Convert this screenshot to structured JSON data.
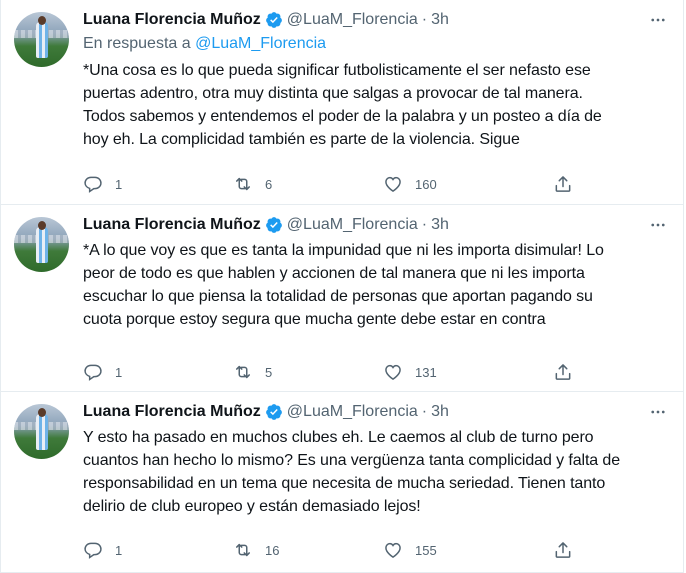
{
  "tweets": [
    {
      "name": "Luana Florencia Muñoz",
      "handle": "@LuaM_Florencia",
      "separator": "·",
      "time": "3h",
      "reply_prefix": "En respuesta a ",
      "reply_handle": "@LuaM_Florencia",
      "text": "*Una cosa es lo que pueda significar futbolisticamente el ser nefasto ese\npuertas adentro, otra muy distinta que salgas a provocar de tal manera.\nTodos sabemos y entendemos el poder de la palabra y un posteo a día de\nhoy eh. La complicidad también es parte de la violencia. Sigue",
      "replies": "1",
      "retweets": "6",
      "likes": "160"
    },
    {
      "name": "Luana Florencia Muñoz",
      "handle": "@LuaM_Florencia",
      "separator": "·",
      "time": "3h",
      "text": "*A lo que voy es que es tanta la impunidad que ni les importa disimular! Lo\npeor de todo es que hablen y accionen de tal manera que ni les importa\nescuchar lo que piensa la totalidad de personas que aportan pagando su\ncuota porque estoy segura que mucha gente debe estar en contra",
      "replies": "1",
      "retweets": "5",
      "likes": "131"
    },
    {
      "name": "Luana Florencia Muñoz",
      "handle": "@LuaM_Florencia",
      "separator": "·",
      "time": "3h",
      "text": "Y esto ha pasado en muchos clubes eh. Le caemos al club de turno pero\ncuantos han hecho lo mismo? Es una vergüenza tanta complicidad y falta de\nresponsabilidad en un tema que necesita de mucha seriedad. Tienen tanto\ndelirio de club europeo y están demasiado lejos!",
      "replies": "1",
      "retweets": "16",
      "likes": "155"
    }
  ],
  "icons": {
    "verified": "verified-badge-icon",
    "more": "more-icon",
    "reply": "reply-icon",
    "retweet": "retweet-icon",
    "like": "heart-icon",
    "share": "share-icon"
  },
  "colors": {
    "accent": "#1d9bf0",
    "secondary_text": "#536471",
    "divider": "#e6ecf0"
  }
}
